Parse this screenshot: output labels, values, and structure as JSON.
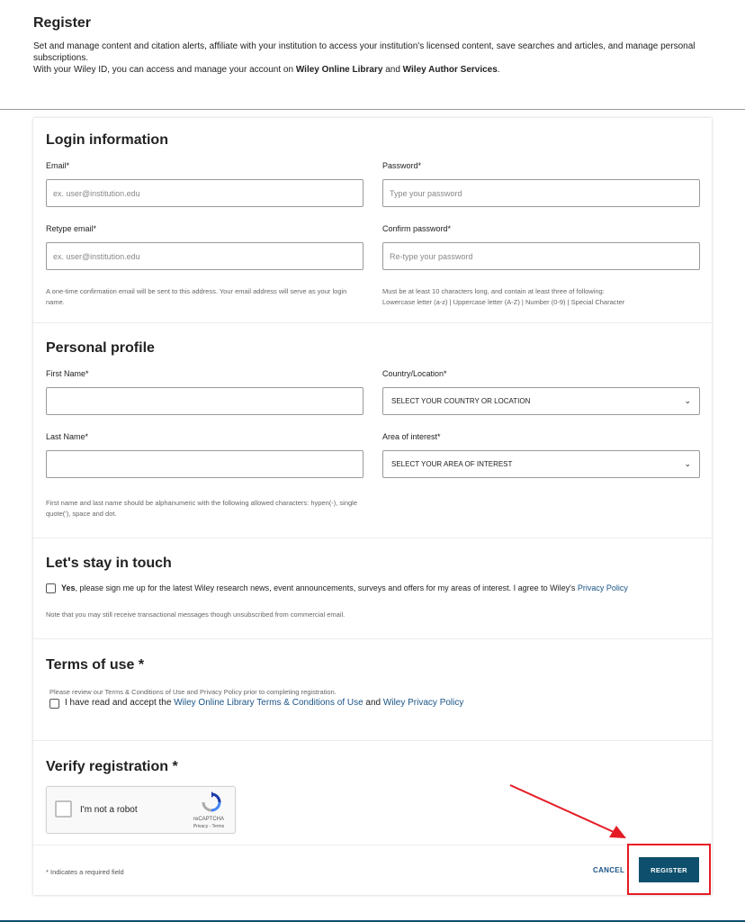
{
  "header": {
    "title": "Register",
    "intro_line1": "Set and manage content and citation alerts, affiliate with your institution to access your institution's licensed content, save searches and articles, and manage personal subscriptions.",
    "intro_line2_prefix": "With your Wiley ID, you can access and manage your account on ",
    "intro_line2_link1": "Wiley Online Library",
    "intro_line2_mid": " and ",
    "intro_line2_link2": "Wiley Author Services",
    "intro_line2_suffix": "."
  },
  "login": {
    "title": "Login information",
    "email_label": "Email*",
    "email_placeholder": "ex. user@institution.edu",
    "password_label": "Password*",
    "password_placeholder": "Type your password",
    "retype_email_label": "Retype email*",
    "retype_email_placeholder": "ex. user@institution.edu",
    "confirm_password_label": "Confirm password*",
    "confirm_password_placeholder": "Re-type your password",
    "email_hint": "A one-time confirmation email will be sent to this address. Your email address will serve as your login name.",
    "password_hint_1": "Must be at least 10 characters long, and contain at least three of following:",
    "password_hint_2": "Lowercase letter (a-z) | Uppercase letter (A-Z) | Number (0-9) | Special Character"
  },
  "profile": {
    "title": "Personal profile",
    "first_name_label": "First Name*",
    "first_name_value": "",
    "last_name_label": "Last Name*",
    "last_name_value": "",
    "country_label": "Country/Location*",
    "country_selected": "SELECT YOUR COUNTRY OR LOCATION",
    "interest_label": "Area of interest*",
    "interest_selected": "SELECT YOUR AREA OF INTEREST",
    "name_hint": "First name and last name should be alphanumeric with the following allowed characters: hypen(-), single quote('), space and dot."
  },
  "touch": {
    "title": "Let's stay in touch",
    "yes": "Yes",
    "optin_text": ", please sign me up for the latest Wiley research news, event announcements, surveys and offers for my areas of interest. I agree to Wiley's ",
    "privacy_link": "Privacy Policy",
    "note": "Note that you may still receive transactional messages though unsubscribed from commercial email."
  },
  "terms": {
    "title": "Terms of use *",
    "review_text": "Please review our Terms & Conditions of Use and Privacy Policy prior to completing registration.",
    "accept_prefix": "I have read and accept the ",
    "terms_link": "Wiley Online Library Terms & Conditions of Use",
    "accept_mid": " and ",
    "privacy_link": "Wiley Privacy Policy"
  },
  "verify": {
    "title": "Verify registration *",
    "captcha_label": "I'm not a robot",
    "captcha_brand": "reCAPTCHA",
    "captcha_links": "Privacy - Terms"
  },
  "footer": {
    "required_note": "* Indicates a required field",
    "cancel_label": "CANCEL",
    "register_label": "REGISTER"
  },
  "colors": {
    "primary": "#0d4f6c",
    "link": "#1a5486",
    "annotation": "#e51b24"
  }
}
